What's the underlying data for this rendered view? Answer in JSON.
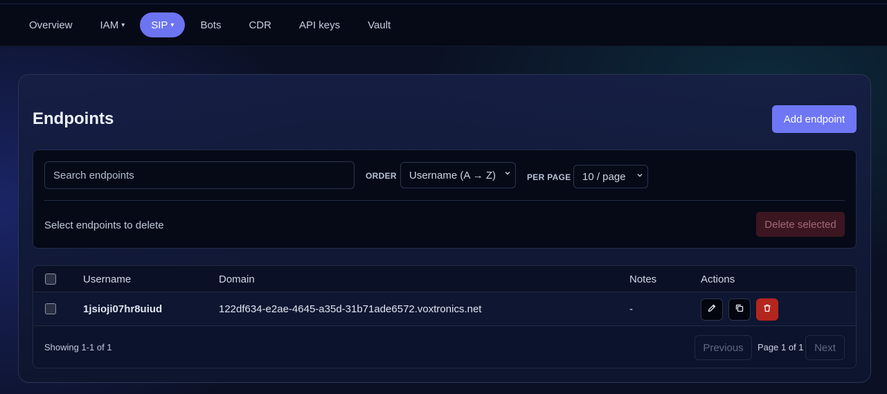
{
  "nav": {
    "items": [
      {
        "label": "Overview",
        "caret": ""
      },
      {
        "label": "IAM",
        "caret": "▾"
      },
      {
        "label": "SIP",
        "caret": "▾"
      },
      {
        "label": "Bots",
        "caret": ""
      },
      {
        "label": "CDR",
        "caret": ""
      },
      {
        "label": "API keys",
        "caret": ""
      },
      {
        "label": "Vault",
        "caret": ""
      }
    ],
    "active": "SIP"
  },
  "page": {
    "title": "Endpoints",
    "add_button": "Add endpoint"
  },
  "filters": {
    "search_placeholder": "Search endpoints",
    "search_value": "",
    "order_label": "ORDER",
    "order_value": "Username (A → Z)",
    "per_page_label": "PER PAGE",
    "per_page_value": "10 / page",
    "hint": "Select endpoints to delete",
    "delete_button": "Delete selected"
  },
  "table": {
    "columns": [
      "Username",
      "Domain",
      "Notes",
      "Actions"
    ],
    "rows": [
      {
        "username": "1jsioji07hr8uiud",
        "domain": "122df634-e2ae-4645-a35d-31b71ade6572.voxtronics.net",
        "notes": "-",
        "actions": [
          "pencil-icon",
          "copy-icon",
          "trash-icon"
        ]
      }
    ]
  },
  "pagination": {
    "showing": "Showing 1-1 of 1",
    "previous": "Previous",
    "page_info": "Page 1 of 1",
    "next": "Next"
  },
  "colors": {
    "accent": "#6f77f5",
    "danger": "#b3261e",
    "background": "#0b1024"
  }
}
